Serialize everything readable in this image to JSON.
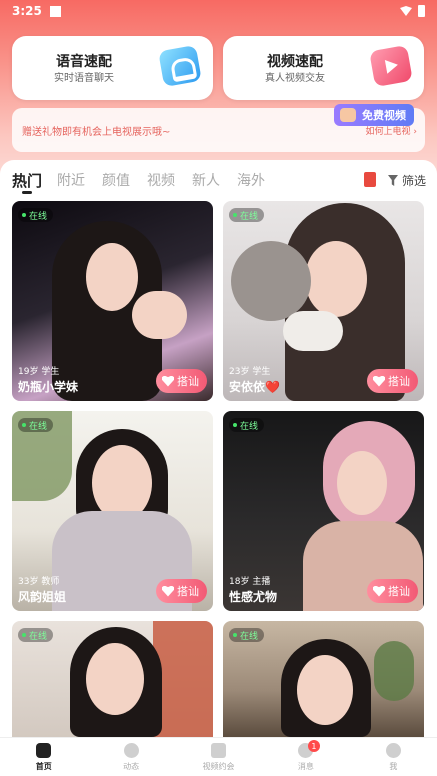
{
  "status": {
    "time": "3:25"
  },
  "quick_cards": [
    {
      "title": "语音速配",
      "subtitle": "实时语音聊天"
    },
    {
      "title": "视频速配",
      "subtitle": "真人视频交友"
    }
  ],
  "banner": {
    "text": "赠送礼物即有机会上电视展示哦~",
    "link": "如何上电视 ›",
    "free_label": "免费视频"
  },
  "tabs": [
    "热门",
    "附近",
    "颜值",
    "视频",
    "新人",
    "海外"
  ],
  "filter_label": "筛选",
  "online_label": "在线",
  "chat_label": "搭讪",
  "cards": [
    {
      "meta": "19岁 学生",
      "name": "奶瓶小学妹"
    },
    {
      "meta": "23岁 学生",
      "name": "安依依❤️"
    },
    {
      "meta": "33岁 教师",
      "name": "风韵姐姐"
    },
    {
      "meta": "18岁 主播",
      "name": "性感尤物"
    },
    {
      "meta": "",
      "name": ""
    },
    {
      "meta": "",
      "name": ""
    }
  ],
  "nav": [
    {
      "label": "首页",
      "icon": "home-icon"
    },
    {
      "label": "动态",
      "icon": "compass-icon"
    },
    {
      "label": "视频约会",
      "icon": "video-icon"
    },
    {
      "label": "消息",
      "icon": "message-icon",
      "badge": "1"
    },
    {
      "label": "我",
      "icon": "profile-icon"
    }
  ]
}
